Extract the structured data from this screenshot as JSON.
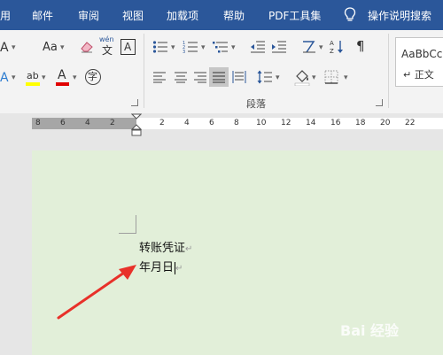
{
  "menu": {
    "items": [
      "用",
      "邮件",
      "审阅",
      "视图",
      "加载项",
      "帮助",
      "PDF工具集",
      "操作说明搜索"
    ]
  },
  "font_group": {
    "grow_font": "A",
    "aa_label": "Aa",
    "font_color_letter": "A",
    "highlight_letter": "ab",
    "enclose_char": "字",
    "phonetic_top": "wén",
    "phonetic_char": "文",
    "border_char": "A",
    "text_effect_letter": "A"
  },
  "paragraph_group": {
    "label": "段落"
  },
  "styles_group": {
    "preview_text": "AaBbCc",
    "style_name": "↵ 正文"
  },
  "ruler": {
    "left_ticks": [
      "8",
      "6",
      "4",
      "2"
    ],
    "right_ticks": [
      "2",
      "4",
      "6",
      "8",
      "10",
      "12",
      "14",
      "16",
      "18",
      "20",
      "22"
    ]
  },
  "document": {
    "line1": "转账凭证",
    "line2": "年月日",
    "paragraph_mark": "↵"
  },
  "watermark": {
    "text": "Bai 经验"
  },
  "colors": {
    "menubar": "#2b579a",
    "page_background": "#e2efd9",
    "arrow": "#e8312a",
    "font_color_underline": "#e00000",
    "highlight_color": "#ffff00"
  },
  "icons": {
    "search": "lightbulb-icon",
    "eraser": "eraser-icon",
    "bullets": "bullets-icon",
    "numbering": "numbering-icon",
    "multilevel": "multilevel-list-icon",
    "decrease_indent": "decrease-indent-icon",
    "increase_indent": "increase-indent-icon",
    "chinese_layout": "chinese-layout-icon",
    "sort": "sort-icon",
    "show_marks": "show-marks-icon",
    "align_left": "align-left-icon",
    "center": "center-icon",
    "align_right": "align-right-icon",
    "justify": "justify-icon",
    "distributed": "distributed-icon",
    "line_spacing": "line-spacing-icon",
    "shading": "shading-icon",
    "borders": "borders-icon"
  }
}
